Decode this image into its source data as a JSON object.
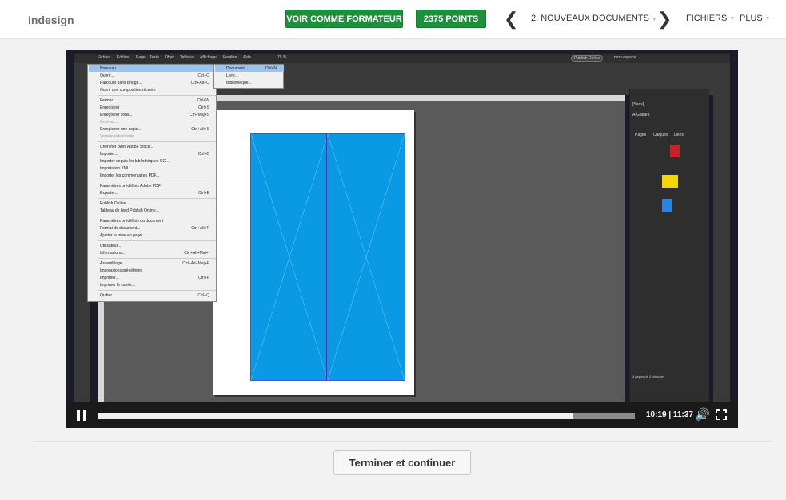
{
  "header": {
    "course_title": "Indesign",
    "formateur_button": "VOIR COMME FORMATEUR",
    "points_button": "2375 POINTS",
    "chapter": "2. NOUVEAUX DOCUMENTS",
    "files_menu": "FICHIERS",
    "more_menu": "PLUS",
    "accent_color": "#1e8f3a"
  },
  "video": {
    "time": "10:19 | 11:37",
    "progress_fraction": 0.886,
    "screen": {
      "menubar": [
        "Fichier",
        "Edition",
        "Page",
        "Texte",
        "Objet",
        "Tableau",
        "Affichage",
        "Fenêtre",
        "Aide"
      ],
      "zoom": "75 %",
      "publish": "Publish Online",
      "workspace": "mon espace",
      "panel_tabs": [
        "Pages",
        "Calques",
        "Liens"
      ],
      "panel_none": "[Sans]",
      "panel_master": "A-Gabarit",
      "panel_status": "4 pages de 3 planches",
      "file_menu": [
        {
          "label": "Nouveau",
          "shortcut": ""
        },
        {
          "label": "Ouvrir...",
          "shortcut": "Ctrl+O"
        },
        {
          "label": "Parcourir dans Bridge...",
          "shortcut": "Ctrl+Alt+O"
        },
        {
          "label": "Ouvrir une composition récente",
          "shortcut": ""
        },
        {
          "label": "Fermer",
          "shortcut": "Ctrl+W"
        },
        {
          "label": "Enregistrer",
          "shortcut": "Ctrl+S"
        },
        {
          "label": "Enregistrer sous...",
          "shortcut": "Ctrl+Maj+S"
        },
        {
          "label": "Archiver...",
          "shortcut": ""
        },
        {
          "label": "Enregistrer une copie...",
          "shortcut": "Ctrl+Alt+S"
        },
        {
          "label": "Version précédente",
          "shortcut": ""
        },
        {
          "label": "Chercher dans Adobe Stock...",
          "shortcut": ""
        },
        {
          "label": "Importer...",
          "shortcut": "Ctrl+D"
        },
        {
          "label": "Importer depuis les bibliothèques CC...",
          "shortcut": ""
        },
        {
          "label": "Importation XML...",
          "shortcut": ""
        },
        {
          "label": "Importer les commentaires PDF...",
          "shortcut": ""
        },
        {
          "label": "Paramètres prédéfinis Adobe PDF",
          "shortcut": ""
        },
        {
          "label": "Exporter...",
          "shortcut": "Ctrl+E"
        },
        {
          "label": "Publish Online...",
          "shortcut": ""
        },
        {
          "label": "Tableau de bord Publish Online...",
          "shortcut": ""
        },
        {
          "label": "Paramètres prédéfinis du document",
          "shortcut": ""
        },
        {
          "label": "Format de document...",
          "shortcut": "Ctrl+Alt+P"
        },
        {
          "label": "Ajuster la mise en page...",
          "shortcut": ""
        },
        {
          "label": "Utilisateur...",
          "shortcut": ""
        },
        {
          "label": "Informations...",
          "shortcut": "Ctrl+Alt+Maj+I"
        },
        {
          "label": "Assemblage...",
          "shortcut": "Ctrl+Alt+Maj+P"
        },
        {
          "label": "Impressions prédéfinies",
          "shortcut": ""
        },
        {
          "label": "Imprimer...",
          "shortcut": "Ctrl+P"
        },
        {
          "label": "Imprimer le cahier...",
          "shortcut": ""
        },
        {
          "label": "Quitter",
          "shortcut": "Ctrl+Q"
        }
      ],
      "sub_menu": [
        {
          "label": "Document...",
          "shortcut": "Ctrl+N"
        },
        {
          "label": "Livre...",
          "shortcut": ""
        },
        {
          "label": "Bibliothèque...",
          "shortcut": ""
        }
      ]
    }
  },
  "footer": {
    "continue_button": "Terminer et continuer"
  }
}
